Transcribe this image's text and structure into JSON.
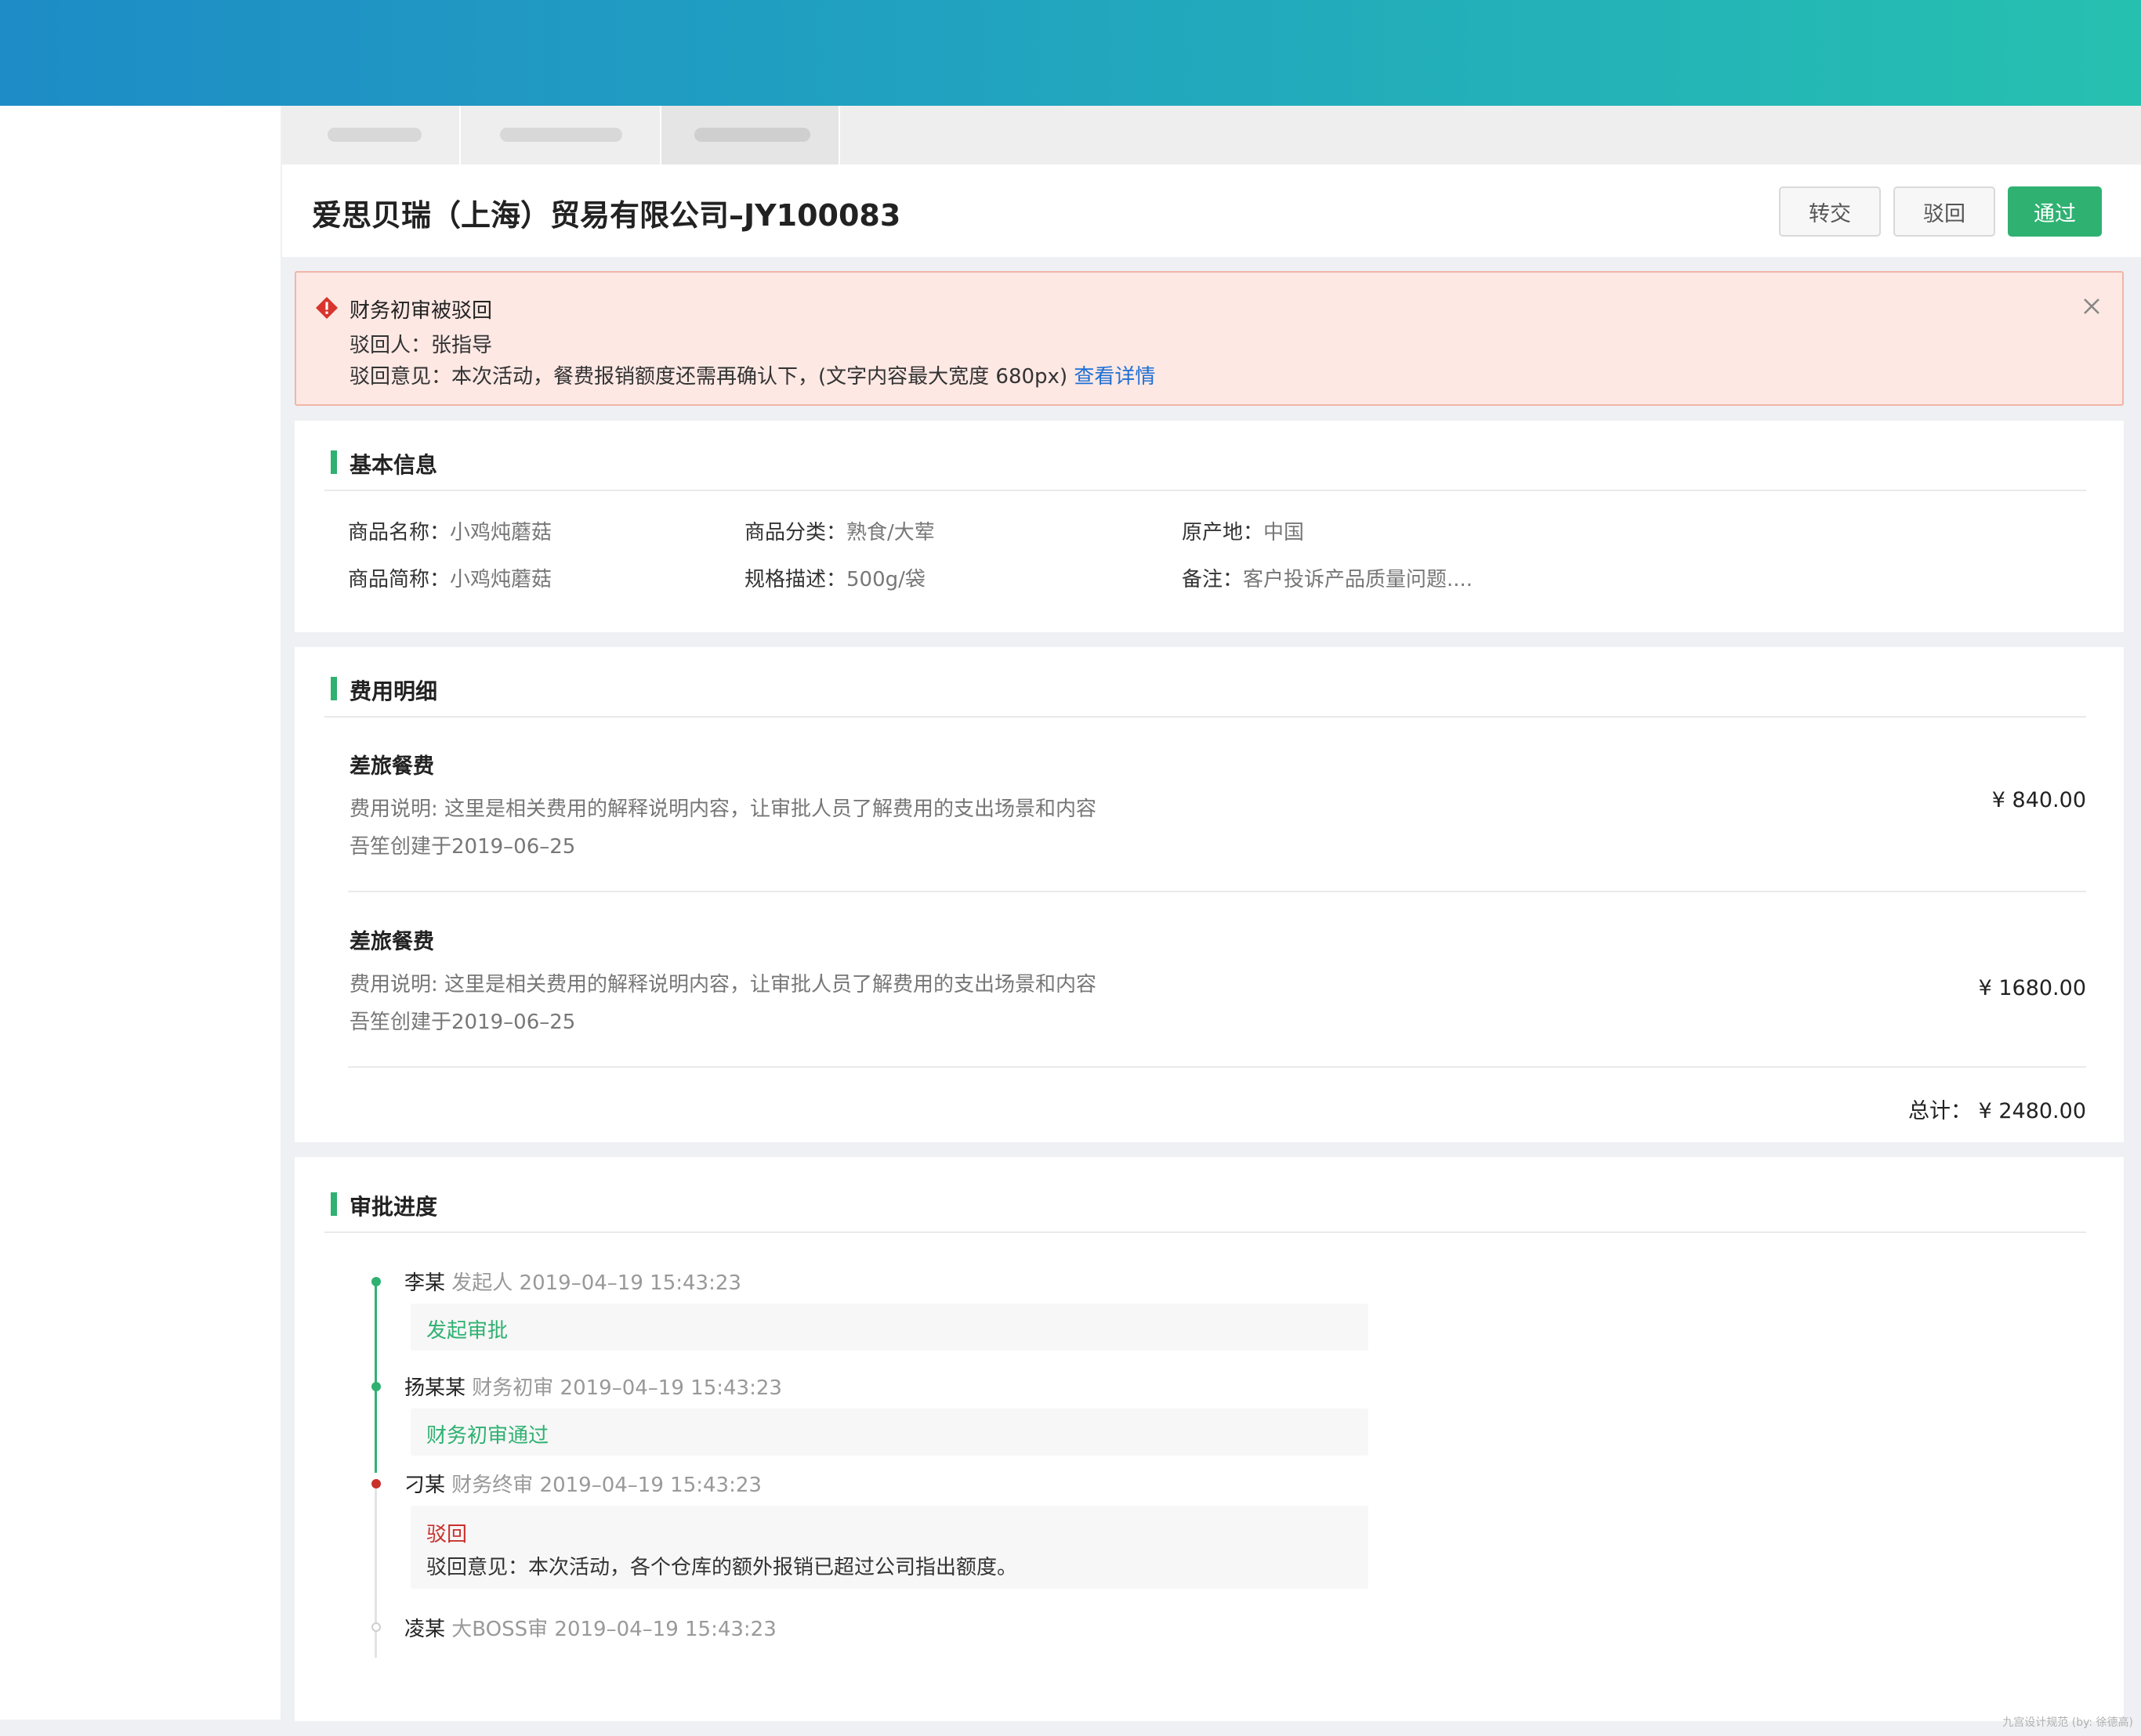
{
  "header": {
    "title": "爱思贝瑞（上海）贸易有限公司–JY100083",
    "buttons": {
      "transfer": "转交",
      "reject": "驳回",
      "approve": "通过"
    }
  },
  "alert": {
    "title": "财务初审被驳回",
    "rejecter_label": "驳回人：",
    "rejecter": "张指导",
    "opinion_label": "驳回意见：",
    "opinion": "本次活动，餐费报销额度还需再确认下，(文字内容最大宽度 680px)",
    "link": "查看详情"
  },
  "basic_info": {
    "title": "基本信息",
    "fields": [
      {
        "label": "商品名称：",
        "value": "小鸡炖蘑菇"
      },
      {
        "label": "商品分类：",
        "value": "熟食/大荤"
      },
      {
        "label": "原产地：",
        "value": "中国"
      },
      {
        "label": "商品简称：",
        "value": "小鸡炖蘑菇"
      },
      {
        "label": "规格描述：",
        "value": "500g/袋"
      },
      {
        "label": "备注：",
        "value": "客户投诉产品质量问题...."
      }
    ]
  },
  "fees": {
    "title": "费用明细",
    "items": [
      {
        "name": "差旅餐费",
        "desc": "费用说明: 这里是相关费用的解释说明内容，让审批人员了解费用的支出场景和内容",
        "created": "吾笙创建于2019–06–25",
        "amount": "¥ 840.00"
      },
      {
        "name": "差旅餐费",
        "desc": "费用说明: 这里是相关费用的解释说明内容，让审批人员了解费用的支出场景和内容",
        "created": "吾笙创建于2019–06–25",
        "amount": "¥ 1680.00"
      }
    ],
    "total": "总计：  ¥ 2480.00"
  },
  "progress": {
    "title": "审批进度",
    "steps": [
      {
        "name": "李某",
        "role": "发起人 2019–04–19 15:43:23",
        "status": "发起审批"
      },
      {
        "name": "扬某某",
        "role": "财务初审 2019–04–19 15:43:23",
        "status": "财务初审通过"
      },
      {
        "name": "刁某",
        "role": "财务终审 2019–04–19 15:43:23",
        "status": "驳回",
        "opinion": "驳回意见：本次活动，各个仓库的额外报销已超过公司指出额度。"
      },
      {
        "name": "凌某",
        "role": "大BOSS审 2019–04–19 15:43:23"
      }
    ]
  },
  "footer": {
    "note": "九宫设计规范 (by: 徐德高)"
  },
  "colors": {
    "accent": "#2fb171",
    "danger": "#c9302c",
    "link": "#1e6fd4"
  }
}
